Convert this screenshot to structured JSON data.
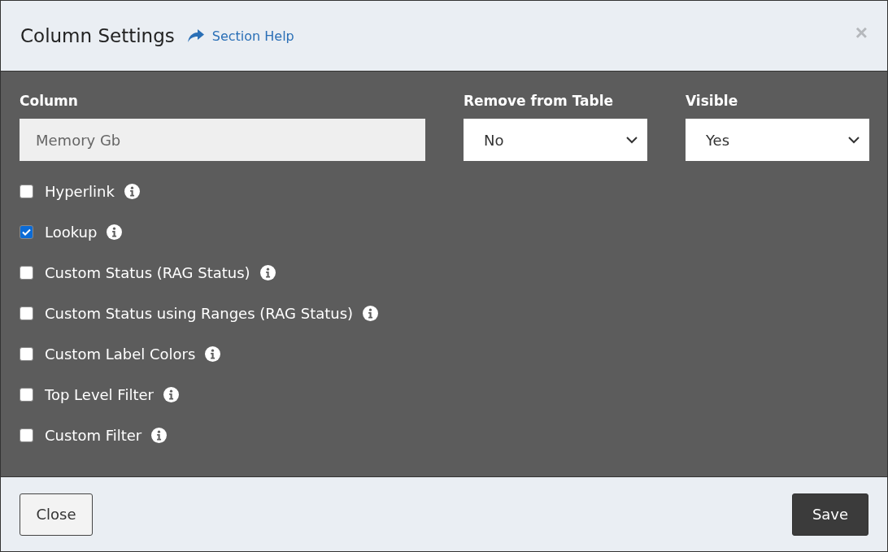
{
  "dialog": {
    "title": "Column Settings",
    "help_link": "Section Help",
    "close_glyph": "×"
  },
  "fields": [
    {
      "kind": "text",
      "label": "Column",
      "value": "Memory Gb"
    },
    {
      "kind": "select",
      "label": "Remove from Table",
      "value": "No"
    },
    {
      "kind": "select",
      "label": "Visible",
      "value": "Yes"
    }
  ],
  "options": [
    {
      "label": "Hyperlink",
      "checked": false
    },
    {
      "label": "Lookup",
      "checked": true
    },
    {
      "label": "Custom Status (RAG Status)",
      "checked": false
    },
    {
      "label": "Custom Status using Ranges (RAG Status)",
      "checked": false
    },
    {
      "label": "Custom Label Colors",
      "checked": false
    },
    {
      "label": "Top Level Filter",
      "checked": false
    },
    {
      "label": "Custom Filter",
      "checked": false
    }
  ],
  "buttons": [
    {
      "kind": "secondary",
      "label": "Close"
    },
    {
      "kind": "primary",
      "label": "Save"
    }
  ]
}
